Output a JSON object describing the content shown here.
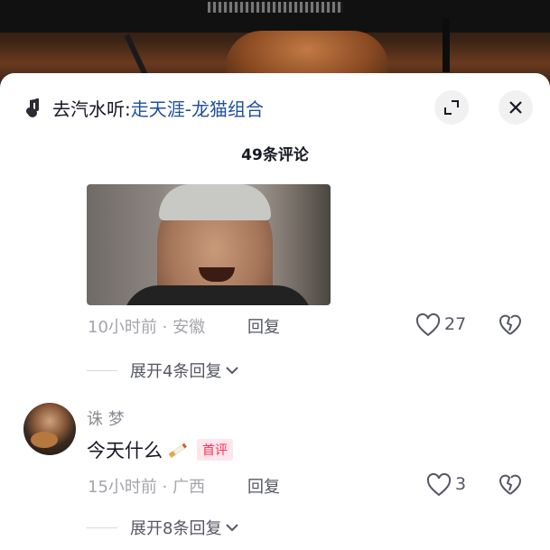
{
  "header": {
    "source_prefix": "去汽水听: ",
    "song": "走天涯-龙猫组合",
    "expand_icon": "expand-icon",
    "close_icon": "close-icon"
  },
  "comment_count": "49条评论",
  "comments": [
    {
      "time_location": "10小时前 · 安徽",
      "reply": "回复",
      "likes": "27",
      "expand_replies": "展开4条回复"
    },
    {
      "username": "诛 梦",
      "text": "今天什么",
      "badge": "首评",
      "time_location": "15小时前 · 广西",
      "reply": "回复",
      "likes": "3",
      "expand_replies": "展开8条回复"
    }
  ],
  "colors": {
    "link": "#1f4f9a",
    "badge": "#fe2c55",
    "muted": "#a4a5ab"
  }
}
